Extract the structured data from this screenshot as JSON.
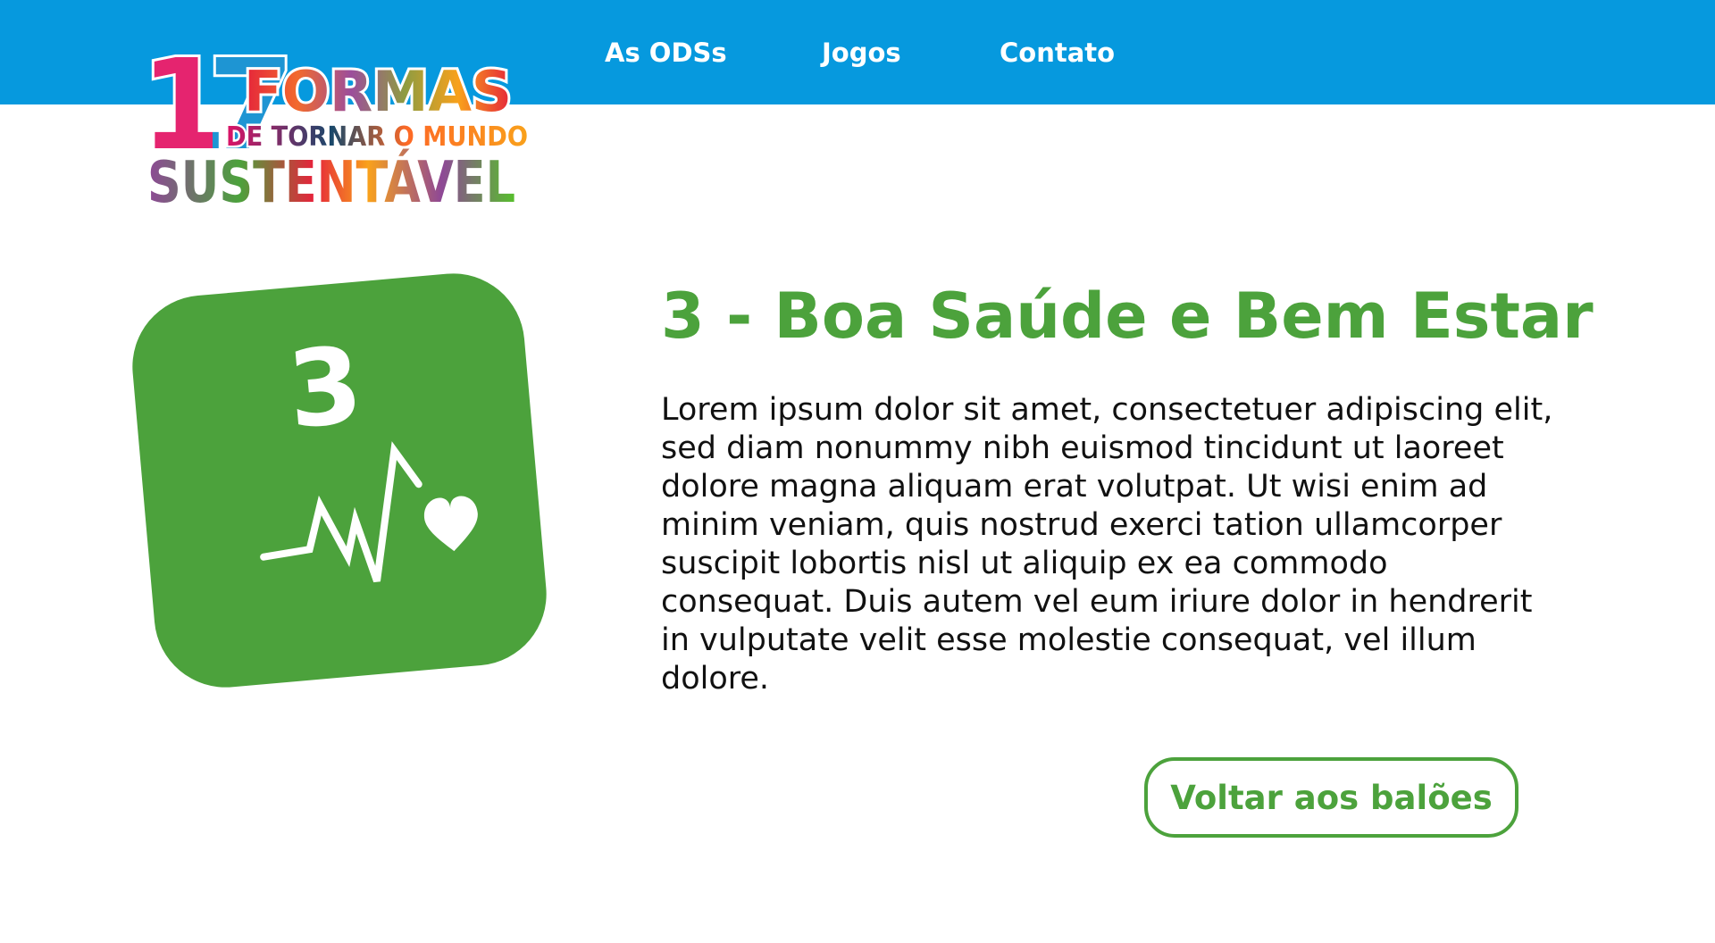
{
  "logo": {
    "number": "17",
    "line1": "FORMAS",
    "line2": "DE TORNAR O MUNDO",
    "line3": "SUSTENTÁVEL"
  },
  "nav": {
    "items": [
      {
        "label": "As ODSs"
      },
      {
        "label": "Jogos"
      },
      {
        "label": "Contato"
      }
    ]
  },
  "ods": {
    "number": "3",
    "icon": "heartbeat-icon",
    "title": "3 - Boa Saúde e Bem Estar",
    "body": "Lorem ipsum dolor sit amet, consectetuer adipiscing elit, sed diam nonummy nibh euismod tincidunt ut laoreet dolore magna aliquam erat volutpat. Ut wisi enim ad minim veniam, quis nostrud exerci tation ullamcorper suscipit lobortis nisl ut aliquip ex ea commodo consequat. Duis autem vel eum iriure dolor in hendrerit in vulputate velit esse molestie consequat, vel illum dolore.",
    "back_button": "Voltar aos balões"
  },
  "colors": {
    "header": "#0699de",
    "ods3_green": "#4ca23c",
    "text": "#111111"
  }
}
